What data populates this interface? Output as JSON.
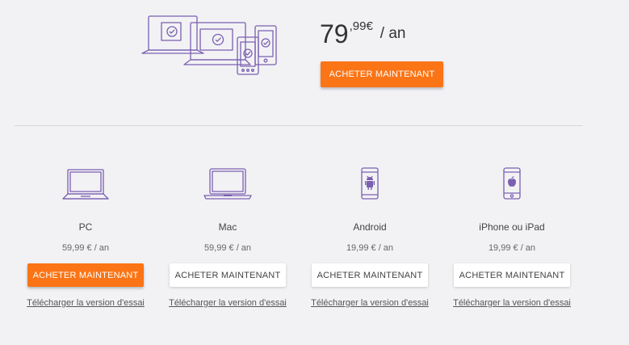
{
  "hero": {
    "price_integer": "79",
    "price_decimal": ",99€",
    "price_period": "/ an",
    "buy_label": "ACHETER MAINTENANT"
  },
  "plans": [
    {
      "name": "PC",
      "price": "59,99 € / an",
      "buy_label": "ACHETER MAINTENANT",
      "trial_label": "Télécharger la version d'essai",
      "icon": "laptop-icon",
      "highlighted": true
    },
    {
      "name": "Mac",
      "price": "59,99 € / an",
      "buy_label": "ACHETER MAINTENANT",
      "trial_label": "Télécharger la version d'essai",
      "icon": "macbook-icon",
      "highlighted": false
    },
    {
      "name": "Android",
      "price": "19,99 € / an",
      "buy_label": "ACHETER MAINTENANT",
      "trial_label": "Télécharger la version d'essai",
      "icon": "android-phone-icon",
      "highlighted": false
    },
    {
      "name": "iPhone ou iPad",
      "price": "19,99 € / an",
      "buy_label": "ACHETER MAINTENANT",
      "trial_label": "Télécharger la version d'essai",
      "icon": "iphone-icon",
      "highlighted": false
    }
  ],
  "colors": {
    "accent": "#fb7415",
    "icon_stroke": "#7b5fb0",
    "background": "#f2f2f5"
  }
}
